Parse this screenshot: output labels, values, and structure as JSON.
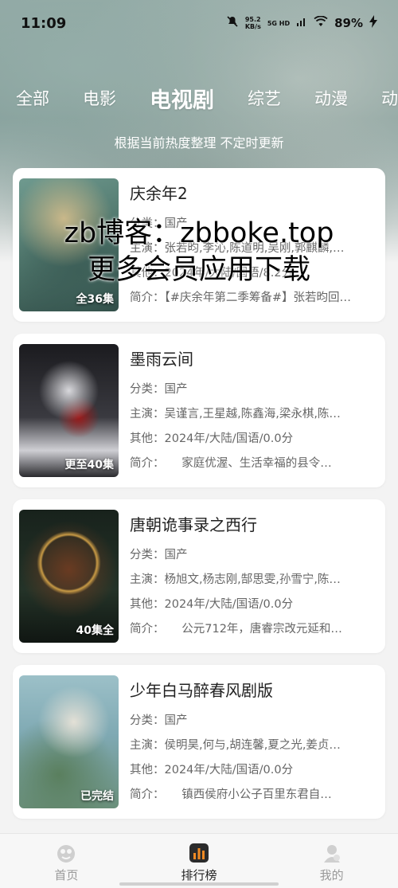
{
  "status_bar": {
    "time": "11:09",
    "net_speed_value": "95.2",
    "net_speed_unit": "KB/s",
    "signal_label": "5G HD",
    "battery": "89%"
  },
  "tabs": [
    {
      "label": "全部",
      "active": false
    },
    {
      "label": "电影",
      "active": false
    },
    {
      "label": "电视剧",
      "active": true
    },
    {
      "label": "综艺",
      "active": false
    },
    {
      "label": "动漫",
      "active": false
    },
    {
      "label": "动画",
      "active": false
    }
  ],
  "subtitle": "根据当前热度整理 不定时更新",
  "watermark": {
    "line1": "zb博客：zbboke.top",
    "line2": "更多会员应用下载"
  },
  "items": [
    {
      "title": "庆余年2",
      "category": "分类：国产",
      "cast": "主演：张若昀,李沁,陈道明,吴刚,郭麒麟,…",
      "other": "其他：2024年/大陆/国语/8.2分",
      "intro": "简介：【#庆余年第二季筹备#】张若昀回…",
      "episode": "全36集",
      "poster_colors": [
        "#5c8a80",
        "#c9b88a",
        "#3d5f58"
      ]
    },
    {
      "title": "墨雨云间",
      "category": "分类：国产",
      "cast": "主演：吴谨言,王星越,陈鑫海,梁永棋,陈…",
      "other": "其他：2024年/大陆/国语/0.0分",
      "intro": "简介：　　家庭优渥、生活幸福的县令…",
      "episode": "更至40集",
      "poster_colors": [
        "#2a2a2e",
        "#d8d8dc",
        "#9b1b1b"
      ]
    },
    {
      "title": "唐朝诡事录之西行",
      "category": "分类：国产",
      "cast": "主演：杨旭文,杨志刚,郜思雯,孙雪宁,陈…",
      "other": "其他：2024年/大陆/国语/0.0分",
      "intro": "简介：　　公元712年，唐睿宗改元延和…",
      "episode": "40集全",
      "poster_colors": [
        "#1e2a22",
        "#c89a45",
        "#6a3b22"
      ]
    },
    {
      "title": "少年白马醉春风剧版",
      "category": "分类：国产",
      "cast": "主演：侯明昊,何与,胡连馨,夏之光,姜贞…",
      "other": "其他：2024年/大陆/国语/0.0分",
      "intro": "简介：　　镇西侯府小公子百里东君自…",
      "episode": "已完结",
      "poster_colors": [
        "#7fa9b3",
        "#e3e0d6",
        "#5a7f5e"
      ]
    }
  ],
  "bottom_nav": [
    {
      "label": "首页",
      "icon": "home-icon",
      "active": false
    },
    {
      "label": "排行榜",
      "icon": "ranking-icon",
      "active": true
    },
    {
      "label": "我的",
      "icon": "profile-icon",
      "active": false
    }
  ]
}
